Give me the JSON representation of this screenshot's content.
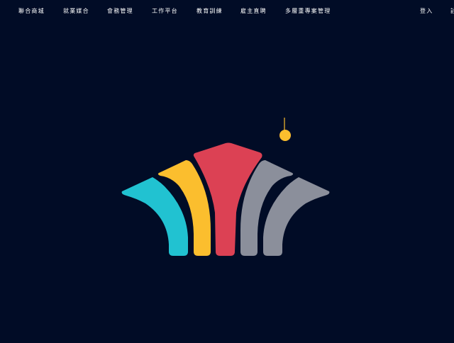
{
  "nav": {
    "items": [
      {
        "label": "聯合商城"
      },
      {
        "label": "就業媒合"
      },
      {
        "label": "會務管理"
      },
      {
        "label": "工作平台"
      },
      {
        "label": "教育訓練"
      },
      {
        "label": "雇主直聘"
      },
      {
        "label": "多層重專案管理"
      }
    ],
    "login_label": "登入",
    "register_label": "註"
  },
  "logo": {
    "colors": {
      "background": "#010c26",
      "teal": "#21c2d1",
      "yellow": "#fbbe2e",
      "red": "#dc4154",
      "gray": "#8b8f9b",
      "dot": "#fbbe2e"
    }
  }
}
